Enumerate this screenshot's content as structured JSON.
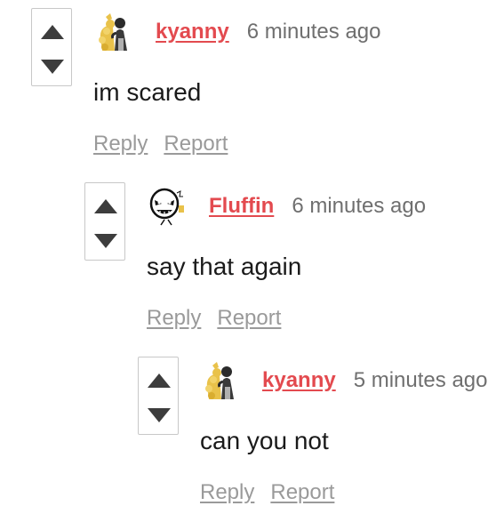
{
  "comments": [
    {
      "username": "kyanny",
      "timestamp": "6 minutes ago",
      "text": "im scared",
      "reply_label": "Reply",
      "report_label": "Report",
      "avatar": "couple-kiss-avatar"
    },
    {
      "username": "Fluffin",
      "timestamp": "6 minutes ago",
      "text": "say that again",
      "reply_label": "Reply",
      "report_label": "Report",
      "avatar": "skull-face-avatar"
    },
    {
      "username": "kyanny",
      "timestamp": "5 minutes ago",
      "text": "can you not",
      "reply_label": "Reply",
      "report_label": "Report",
      "avatar": "couple-kiss-avatar"
    }
  ],
  "colors": {
    "username": "#e34a4f",
    "timestamp": "#6f6f6f",
    "action_link": "#9a9a9a",
    "vote_arrow": "#3d3d3d",
    "vote_border": "#c8c8c8"
  },
  "icons": {
    "upvote": "triangle-up-icon",
    "downvote": "triangle-down-icon"
  }
}
